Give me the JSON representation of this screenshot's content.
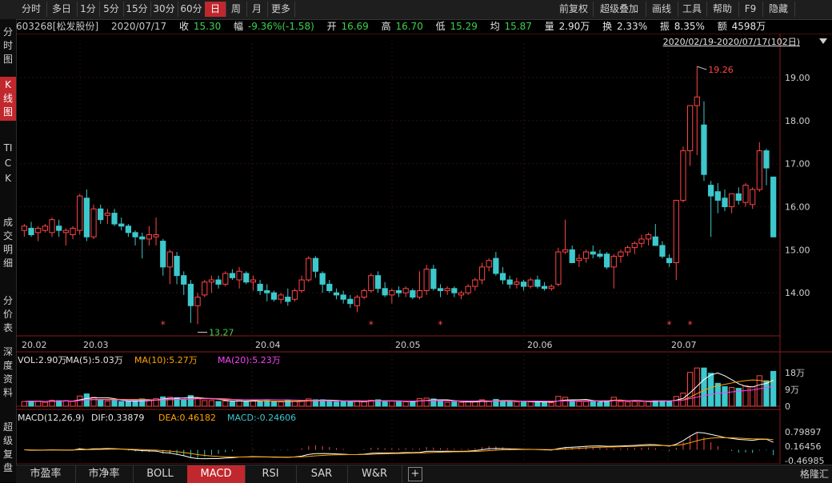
{
  "toolbar": {
    "periods": [
      "分时",
      "多日",
      "1分",
      "5分",
      "15分",
      "30分",
      "60分",
      "日",
      "周",
      "月",
      "更多"
    ],
    "active_period": "日",
    "right_items": [
      "前复权",
      "超级叠加",
      "画线",
      "工具",
      "帮助",
      "F9",
      "隐藏"
    ]
  },
  "left_tabs": [
    {
      "label": "分时图",
      "active": false
    },
    {
      "label": "K线图",
      "active": true
    },
    {
      "label": "TICK",
      "active": false
    },
    {
      "label": "成交明细",
      "active": false
    },
    {
      "label": "分价表",
      "active": false
    },
    {
      "label": "深度资料",
      "active": false
    },
    {
      "label": "超级复盘",
      "active": false
    }
  ],
  "quote": {
    "code_name": "603268[松发股份]",
    "date": "2020/07/17",
    "close_label": "收",
    "close": "15.30",
    "change_label": "幅",
    "change": "-9.36%(-1.58)",
    "open_label": "开",
    "open": "16.69",
    "high_label": "高",
    "high": "16.70",
    "low_label": "低",
    "low": "15.29",
    "avg_label": "均",
    "avg": "15.87",
    "volume_label": "量",
    "volume": "2.90万",
    "turnover_label": "换",
    "turnover": "2.33%",
    "amplitude_label": "振",
    "amplitude": "8.35%",
    "amount_label": "额",
    "amount": "4598万"
  },
  "range_label": "2020/02/19-2020/07/17(102日)",
  "volume_legend": {
    "vol": "VOL:2.90万",
    "ma5": "MA(5):5.03万",
    "ma10": "MA(10):5.27万",
    "ma20": "MA(20):5.23万"
  },
  "macd_legend": {
    "title": "MACD(12,26,9)",
    "dif": "DIF:0.33879",
    "dea": "DEA:0.46182",
    "macd": "MACD:-0.24606"
  },
  "bottom_tabs": [
    "市盈率",
    "市净率",
    "BOLL",
    "MACD",
    "RSI",
    "SAR",
    "W&R",
    "+"
  ],
  "active_bottom_tab": "MACD",
  "logo_text": "格隆汇",
  "colors": {
    "up": "#ff4545",
    "down": "#3cc8cc",
    "ma5": "#ffffff",
    "ma10": "#ffa500",
    "ma20": "#ff40ff",
    "grid": "#2a1010"
  },
  "chart_data": [
    {
      "type": "candlestick",
      "title": "",
      "x_tick_labels": [
        "20.02",
        "20.03",
        "20.04",
        "20.05",
        "20.06",
        "20.07"
      ],
      "y_tick_labels": [
        "14.00",
        "15.00",
        "16.00",
        "17.00",
        "18.00",
        "19.00"
      ],
      "ylim": [
        13.0,
        19.8
      ],
      "max_annotation": "19.26",
      "min_annotation": "13.27",
      "ohlc": [
        [
          15.45,
          15.6,
          15.3,
          15.55
        ],
        [
          15.5,
          15.65,
          15.3,
          15.35
        ],
        [
          15.4,
          15.55,
          15.2,
          15.5
        ],
        [
          15.45,
          15.6,
          15.4,
          15.55
        ],
        [
          15.4,
          15.75,
          15.3,
          15.7
        ],
        [
          15.55,
          15.7,
          15.3,
          15.45
        ],
        [
          15.4,
          15.5,
          15.1,
          15.45
        ],
        [
          15.35,
          15.55,
          15.25,
          15.5
        ],
        [
          15.45,
          16.3,
          15.35,
          16.25
        ],
        [
          16.2,
          16.4,
          15.2,
          15.3
        ],
        [
          15.3,
          16.05,
          15.25,
          15.95
        ],
        [
          15.95,
          16.05,
          15.6,
          15.7
        ],
        [
          15.8,
          15.95,
          15.6,
          15.85
        ],
        [
          15.85,
          15.95,
          15.55,
          15.6
        ],
        [
          15.6,
          15.75,
          15.45,
          15.55
        ],
        [
          15.55,
          15.6,
          15.3,
          15.4
        ],
        [
          15.4,
          15.45,
          15.1,
          15.3
        ],
        [
          15.3,
          15.4,
          14.8,
          15.25
        ],
        [
          15.25,
          15.55,
          15.1,
          15.35
        ],
        [
          15.3,
          15.75,
          15.1,
          15.35
        ],
        [
          15.2,
          15.25,
          14.4,
          14.6
        ],
        [
          14.6,
          15.0,
          14.2,
          14.95
        ],
        [
          14.85,
          14.95,
          14.2,
          14.4
        ],
        [
          14.4,
          14.5,
          13.95,
          14.2
        ],
        [
          14.2,
          14.3,
          13.3,
          13.7
        ],
        [
          13.7,
          14.0,
          13.27,
          13.9
        ],
        [
          13.95,
          14.3,
          13.9,
          14.25
        ],
        [
          14.25,
          14.4,
          14.0,
          14.3
        ],
        [
          14.3,
          14.4,
          14.1,
          14.2
        ],
        [
          14.2,
          14.5,
          14.15,
          14.45
        ],
        [
          14.45,
          14.55,
          14.3,
          14.35
        ],
        [
          14.3,
          14.6,
          14.1,
          14.5
        ],
        [
          14.45,
          14.5,
          14.2,
          14.25
        ],
        [
          14.25,
          14.4,
          14.05,
          14.3
        ],
        [
          14.2,
          14.3,
          13.95,
          14.05
        ],
        [
          14.05,
          14.2,
          13.8,
          14.0
        ],
        [
          14.0,
          14.05,
          13.8,
          13.85
        ],
        [
          13.85,
          14.0,
          13.75,
          13.95
        ],
        [
          13.9,
          14.1,
          13.7,
          13.8
        ],
        [
          13.85,
          14.1,
          13.8,
          14.05
        ],
        [
          14.05,
          14.4,
          14.0,
          14.3
        ],
        [
          14.3,
          14.85,
          14.25,
          14.8
        ],
        [
          14.8,
          14.85,
          14.35,
          14.5
        ],
        [
          14.45,
          14.5,
          14.0,
          14.2
        ],
        [
          14.2,
          14.3,
          14.0,
          14.05
        ],
        [
          14.0,
          14.1,
          13.85,
          13.95
        ],
        [
          13.95,
          14.05,
          13.75,
          13.85
        ],
        [
          13.85,
          13.95,
          13.65,
          13.75
        ],
        [
          13.7,
          13.95,
          13.55,
          13.9
        ],
        [
          13.9,
          14.1,
          13.85,
          14.05
        ],
        [
          14.05,
          14.45,
          14.0,
          14.4
        ],
        [
          14.4,
          14.5,
          14.0,
          14.1
        ],
        [
          14.1,
          14.25,
          13.9,
          13.95
        ],
        [
          13.95,
          14.1,
          13.75,
          14.05
        ],
        [
          14.05,
          14.15,
          13.9,
          14.0
        ],
        [
          14.0,
          14.15,
          13.9,
          14.1
        ],
        [
          14.05,
          14.1,
          13.85,
          13.9
        ],
        [
          13.9,
          14.5,
          13.85,
          14.05
        ],
        [
          14.05,
          14.65,
          13.95,
          14.55
        ],
        [
          14.55,
          14.65,
          14.05,
          14.1
        ],
        [
          14.1,
          14.2,
          13.9,
          14.05
        ],
        [
          14.05,
          14.15,
          13.95,
          14.1
        ],
        [
          14.1,
          14.15,
          13.9,
          14.0
        ],
        [
          13.95,
          14.05,
          13.85,
          14.0
        ],
        [
          14.0,
          14.2,
          13.95,
          14.15
        ],
        [
          14.15,
          14.35,
          14.05,
          14.3
        ],
        [
          14.3,
          14.7,
          14.2,
          14.6
        ],
        [
          14.6,
          14.8,
          14.5,
          14.75
        ],
        [
          14.8,
          14.95,
          14.4,
          14.45
        ],
        [
          14.45,
          14.6,
          14.2,
          14.3
        ],
        [
          14.3,
          14.4,
          14.1,
          14.2
        ],
        [
          14.2,
          14.35,
          14.1,
          14.25
        ],
        [
          14.25,
          14.3,
          14.05,
          14.15
        ],
        [
          14.15,
          14.35,
          14.1,
          14.3
        ],
        [
          14.3,
          14.4,
          14.1,
          14.15
        ],
        [
          14.15,
          14.25,
          14.05,
          14.1
        ],
        [
          14.1,
          14.2,
          14.05,
          14.15
        ],
        [
          14.2,
          15.05,
          14.15,
          14.95
        ],
        [
          14.95,
          15.7,
          14.9,
          15.0
        ],
        [
          15.0,
          15.1,
          14.7,
          14.7
        ],
        [
          14.75,
          14.9,
          14.6,
          14.8
        ],
        [
          14.8,
          15.0,
          14.7,
          14.95
        ],
        [
          14.95,
          15.1,
          14.8,
          14.9
        ],
        [
          14.9,
          15.0,
          14.8,
          14.85
        ],
        [
          14.9,
          14.95,
          14.55,
          14.6
        ],
        [
          14.6,
          14.9,
          14.1,
          14.85
        ],
        [
          14.85,
          15.0,
          14.7,
          14.95
        ],
        [
          14.95,
          15.1,
          14.85,
          15.05
        ],
        [
          15.05,
          15.2,
          14.9,
          15.15
        ],
        [
          15.15,
          15.35,
          15.05,
          15.25
        ],
        [
          15.25,
          15.4,
          15.1,
          15.35
        ],
        [
          15.3,
          15.6,
          15.2,
          15.1
        ],
        [
          15.1,
          15.2,
          14.8,
          14.85
        ],
        [
          14.8,
          14.9,
          14.6,
          14.7
        ],
        [
          14.7,
          15.2,
          14.3,
          16.15
        ],
        [
          16.15,
          17.4,
          16.1,
          17.3
        ],
        [
          17.3,
          18.3,
          16.95,
          18.35
        ],
        [
          18.35,
          19.26,
          17.2,
          18.55
        ],
        [
          17.9,
          18.45,
          16.6,
          16.75
        ],
        [
          16.5,
          16.6,
          15.3,
          16.25
        ],
        [
          16.35,
          16.55,
          15.85,
          16.15
        ]
      ],
      "ohlc_tail": [
        [
          16.2,
          16.4,
          15.9,
          16.0
        ],
        [
          16.0,
          16.3,
          15.85,
          16.3
        ],
        [
          16.3,
          16.45,
          16.05,
          16.15
        ],
        [
          16.1,
          16.55,
          16.0,
          16.5
        ],
        [
          16.05,
          16.45,
          15.95,
          16.4
        ],
        [
          16.4,
          17.5,
          16.35,
          17.3
        ],
        [
          17.3,
          17.35,
          16.5,
          16.9
        ],
        [
          16.69,
          16.7,
          15.29,
          15.3
        ]
      ],
      "star_indices": [
        20,
        50,
        60,
        93,
        96,
        115,
        116,
        118,
        128
      ]
    },
    {
      "type": "bar",
      "title": "",
      "y_tick_labels": [
        "18万",
        "9万",
        "0"
      ],
      "ylim": [
        0,
        21
      ],
      "series_unit": "万"
    },
    {
      "type": "line",
      "title": "",
      "y_tick_labels": [
        "0.79897",
        "0.16456",
        "-0.46985"
      ],
      "ylim": [
        -0.62,
        1.05
      ]
    }
  ]
}
